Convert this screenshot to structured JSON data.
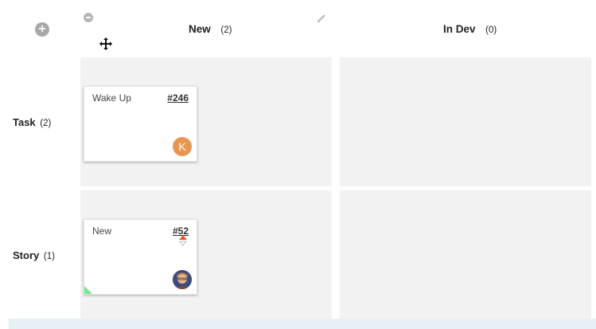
{
  "columns": [
    {
      "title": "New",
      "count": "(2)"
    },
    {
      "title": "In Dev",
      "count": "(0)"
    }
  ],
  "rows": [
    {
      "title": "Task",
      "count": "(2)"
    },
    {
      "title": "Story",
      "count": "(1)"
    }
  ],
  "cards": [
    {
      "title": "Wake Up",
      "id": "#246",
      "avatar_initial": "K",
      "avatar_color": "#e8964f"
    },
    {
      "title": "New",
      "id": "#52",
      "ribbon": "new",
      "ribbon_color": "#74e88e",
      "priority_color": "#f05a28"
    }
  ],
  "colors": {
    "lane_bg": "#f2f2f2",
    "ribbon": "#74e88e",
    "avatar_k": "#e8964f"
  }
}
